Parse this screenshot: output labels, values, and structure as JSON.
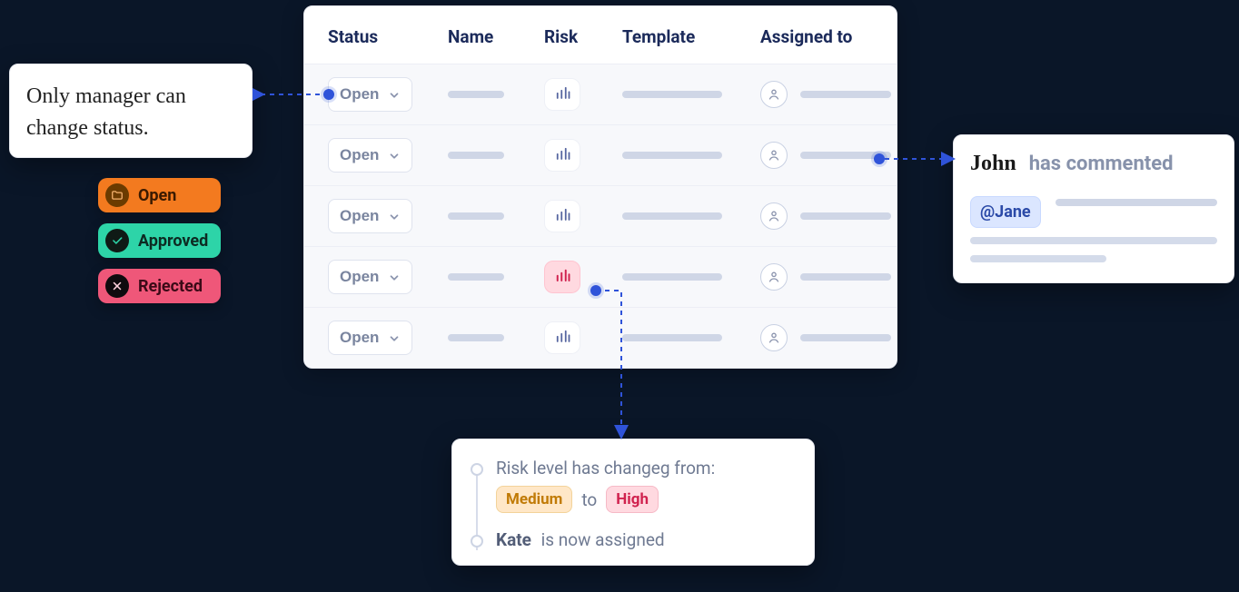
{
  "table": {
    "headers": {
      "status": "Status",
      "name": "Name",
      "risk": "Risk",
      "template": "Template",
      "assigned_to": "Assigned to"
    },
    "status_label": "Open"
  },
  "note": {
    "text": "Only manager can change status."
  },
  "status_tags": {
    "open": "Open",
    "approved": "Approved",
    "rejected": "Rejected"
  },
  "comment": {
    "author": "John",
    "verb": "has commented",
    "mention": "@Jane"
  },
  "activity": {
    "risk_line": "Risk level has changeg from:",
    "risk_from": "Medium",
    "risk_sep": "to",
    "risk_to": "High",
    "assign_name": "Kate",
    "assign_rest": "is now assigned"
  }
}
